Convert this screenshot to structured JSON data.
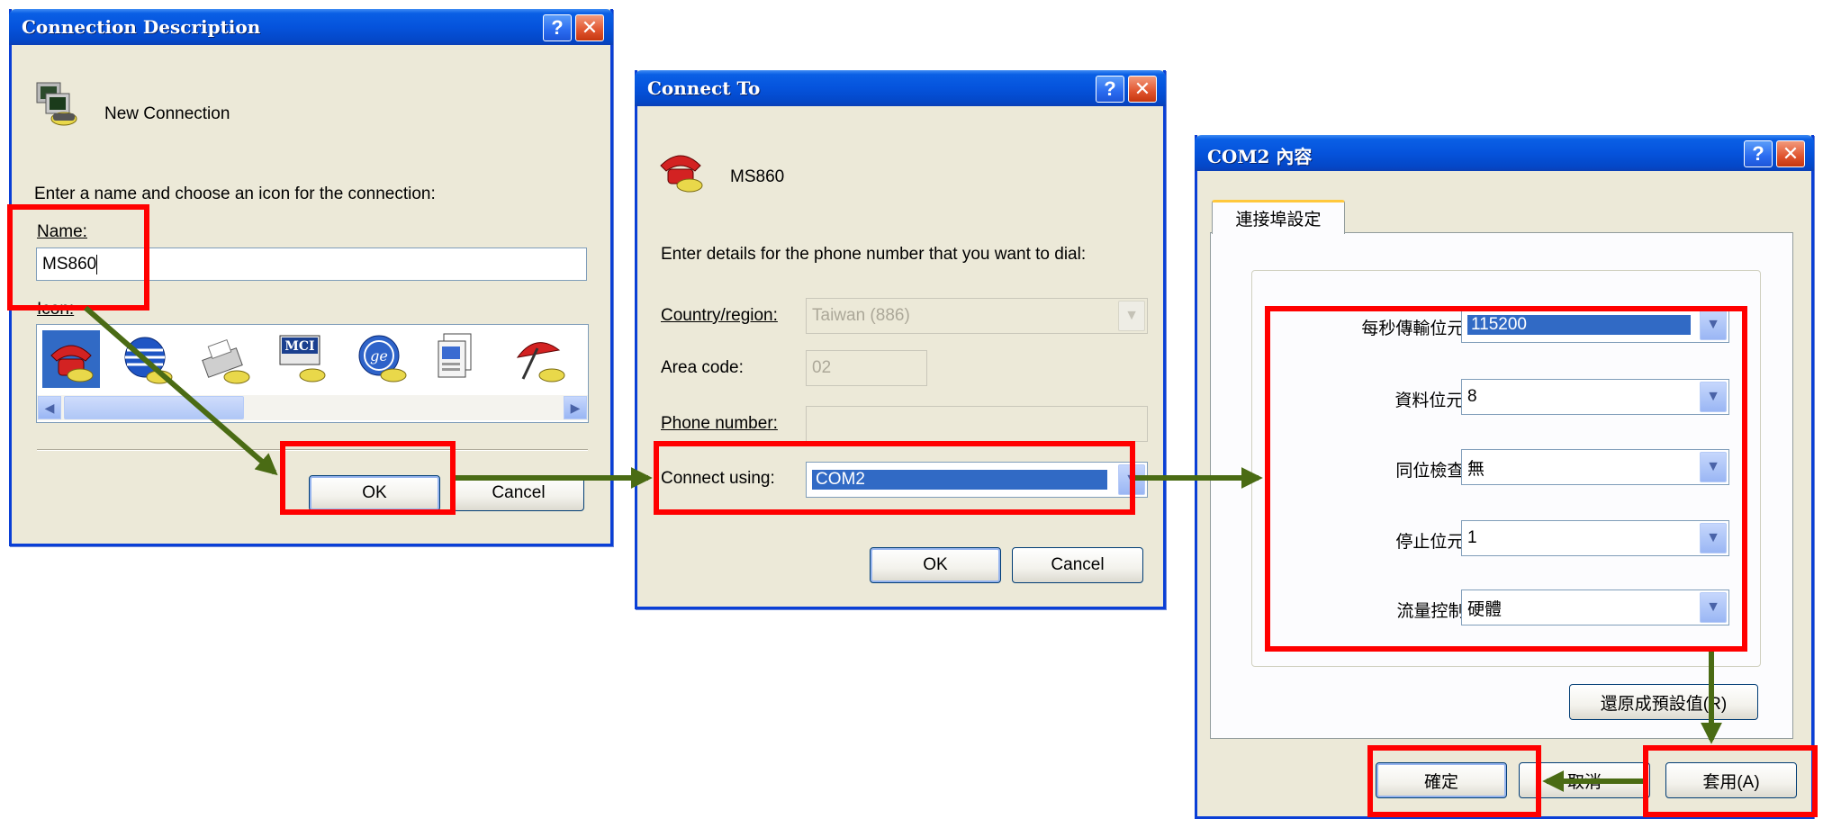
{
  "dialog1": {
    "title": "Connection Description",
    "help_label": "?",
    "close_label": "✕",
    "header_text": "New Connection",
    "instruction": "Enter a name and choose an icon for the connection:",
    "name_label": "Name:",
    "name_value": "MS860",
    "icon_label": "Icon:",
    "icon_items": [
      "red-phone",
      "globe",
      "fax",
      "mci",
      "ge",
      "document",
      "umbrella"
    ],
    "ok_label": "OK",
    "cancel_label": "Cancel"
  },
  "dialog2": {
    "title": "Connect To",
    "help_label": "?",
    "close_label": "✕",
    "header_text": "MS860",
    "instruction": "Enter details for the phone number that you want to dial:",
    "country_label": "Country/region:",
    "country_value": "Taiwan (886)",
    "area_label": "Area code:",
    "area_value": "02",
    "phone_label": "Phone number:",
    "phone_value": "",
    "connect_label": "Connect using:",
    "connect_value": "COM2",
    "ok_label": "OK",
    "cancel_label": "Cancel"
  },
  "dialog3": {
    "title": "COM2 內容",
    "help_label": "?",
    "close_label": "✕",
    "tab_label": "連接埠設定",
    "rows": [
      {
        "label": "每秒傳輸位元(B):",
        "value": "115200"
      },
      {
        "label": "資料位元(D):",
        "value": "8"
      },
      {
        "label": "同位檢查(P):",
        "value": "無"
      },
      {
        "label": "停止位元(S):",
        "value": "1"
      },
      {
        "label": "流量控制(F):",
        "value": "硬體"
      }
    ],
    "restore_label": "還原成預設值(R)",
    "ok_label": "確定",
    "cancel_label": "取消",
    "apply_label": "套用(A)"
  },
  "colors": {
    "highlight_box": "#ff0000",
    "flow_arrow": "#4a6b14",
    "titlebar": "#0553dc",
    "dialog_face": "#ece9d8",
    "selection": "#316ac5"
  }
}
